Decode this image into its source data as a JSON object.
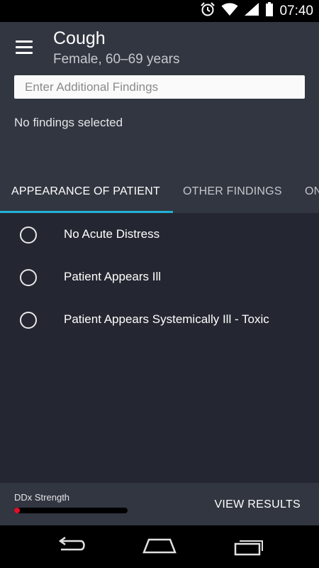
{
  "status_bar": {
    "time": "07:40",
    "icons": [
      "alarm-icon",
      "wifi-icon",
      "signal-icon",
      "battery-icon"
    ]
  },
  "header": {
    "menu_icon": "hamburger-menu-icon",
    "title": "Cough",
    "subtitle": "Female, 60–69 years",
    "search_placeholder": "Enter Additional Findings",
    "search_value": "",
    "selected_status": "No findings selected"
  },
  "tabs": [
    {
      "label": "APPEARANCE OF PATIENT",
      "active": true
    },
    {
      "label": "OTHER FINDINGS",
      "active": false
    },
    {
      "label": "ON",
      "active": false
    }
  ],
  "options": [
    {
      "label": "No Acute Distress",
      "selected": false
    },
    {
      "label": "Patient Appears Ill",
      "selected": false
    },
    {
      "label": "Patient Appears Systemically Ill - Toxic",
      "selected": false
    }
  ],
  "footer": {
    "ddx_label": "DDx Strength",
    "ddx_strength": 0.03,
    "view_results_label": "VIEW RESULTS"
  },
  "nav_bar": {
    "icons": [
      "back-icon",
      "home-icon",
      "recent-apps-icon"
    ]
  },
  "colors": {
    "header_bg": "#323641",
    "content_bg": "#242731",
    "accent": "#22b2d8",
    "strength": "#e0102a"
  }
}
